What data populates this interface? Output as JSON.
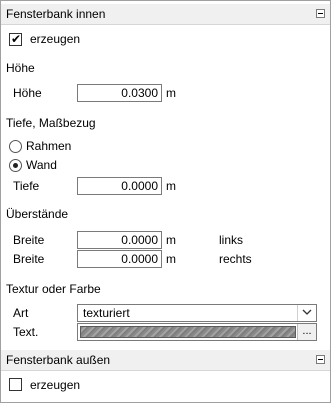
{
  "sections": {
    "inner": {
      "title": "Fensterbank innen",
      "create_label": "erzeugen",
      "create_checked": true
    },
    "outer": {
      "title": "Fensterbank außen",
      "create_label": "erzeugen",
      "create_checked": false
    }
  },
  "hoehe": {
    "heading": "Höhe",
    "label": "Höhe",
    "value": "0.0300",
    "unit": "m"
  },
  "tiefe": {
    "heading": "Tiefe, Maßbezug",
    "radio_rahmen": "Rahmen",
    "radio_wand": "Wand",
    "selected": "Wand",
    "label": "Tiefe",
    "value": "0.0000",
    "unit": "m"
  },
  "ueberstaende": {
    "heading": "Überstände",
    "rows": [
      {
        "label": "Breite",
        "value": "0.0000",
        "unit": "m",
        "side": "links"
      },
      {
        "label": "Breite",
        "value": "0.0000",
        "unit": "m",
        "side": "rechts"
      }
    ]
  },
  "textur": {
    "heading": "Textur oder Farbe",
    "art_label": "Art",
    "art_value": "texturiert",
    "text_label": "Text.",
    "more_button": "..."
  },
  "icons": {
    "collapse": "collapse-minus-icon",
    "dropdown": "chevron-down-icon",
    "check": "checkmark-icon"
  }
}
